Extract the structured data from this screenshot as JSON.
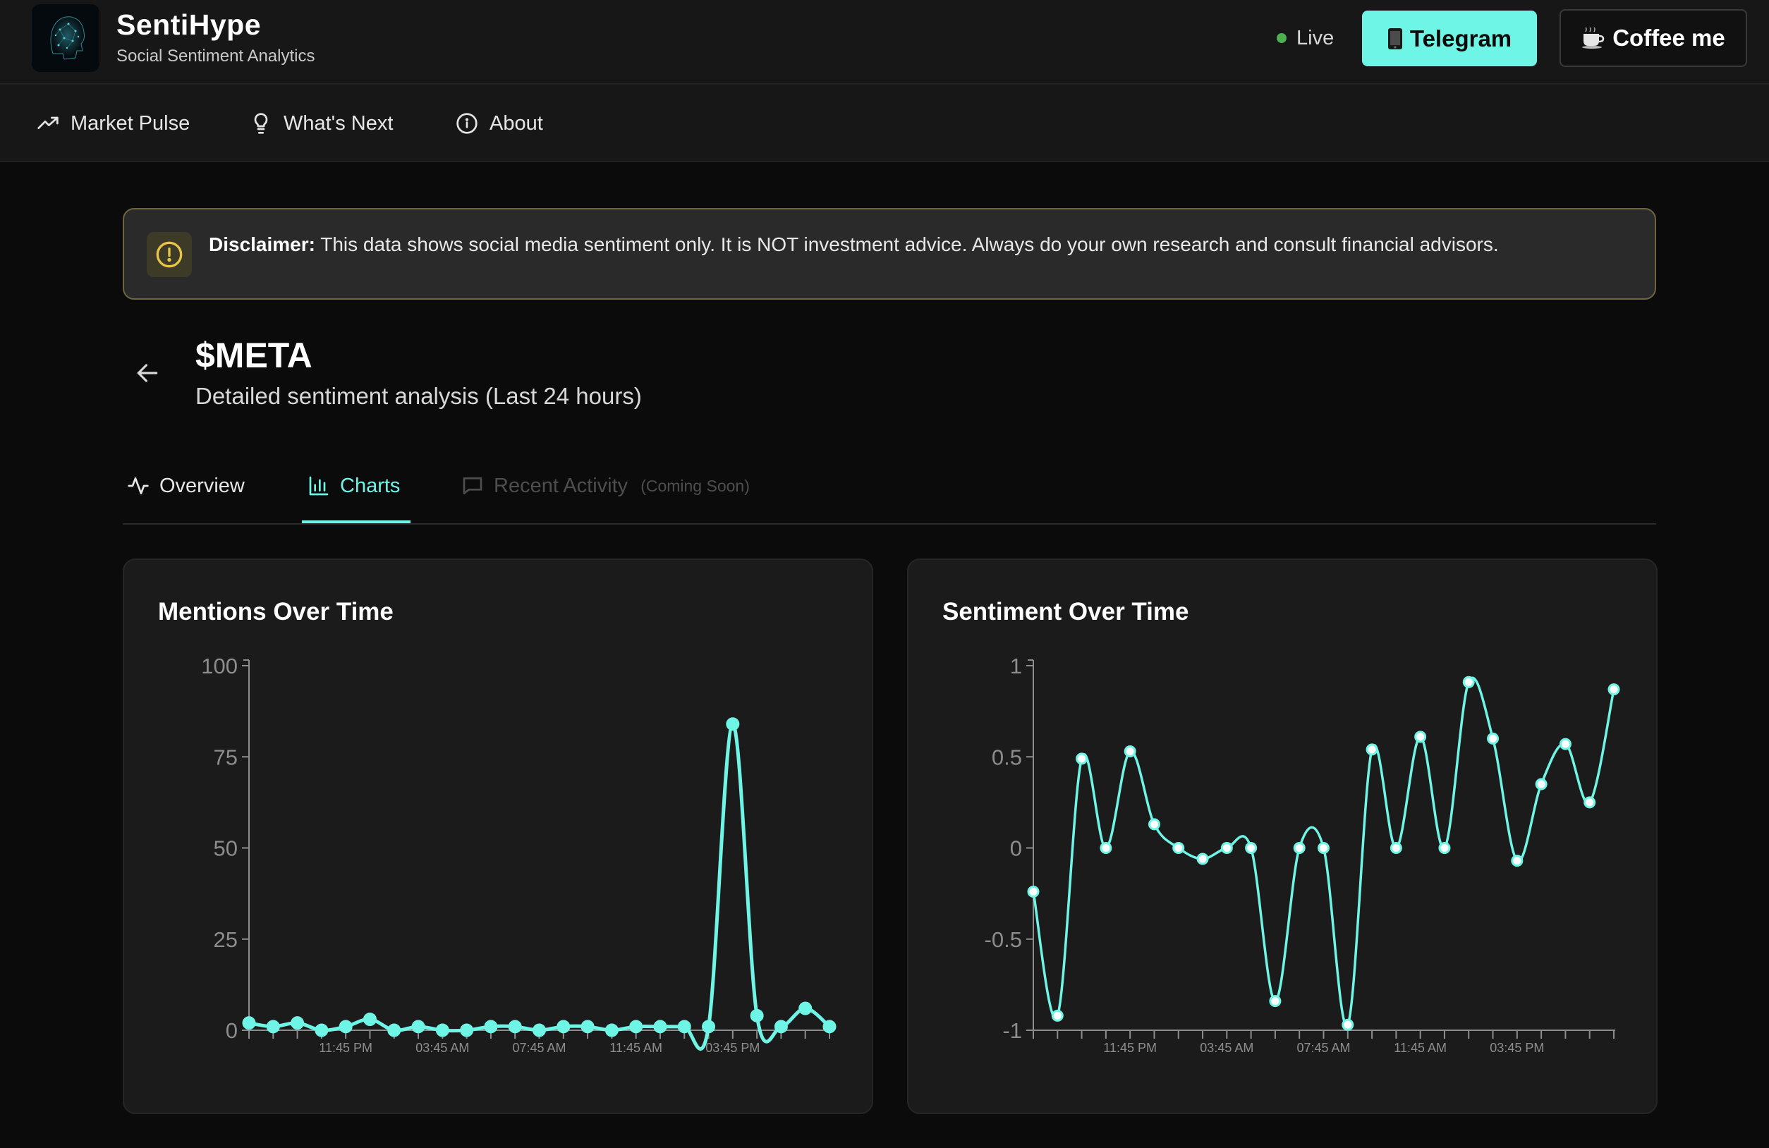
{
  "header": {
    "brand_title": "SentiHype",
    "brand_subtitle": "Social Sentiment Analytics",
    "live_label": "Live",
    "telegram_label": "Telegram",
    "telegram_icon": "phone-icon",
    "coffee_label": "Coffee me",
    "coffee_icon": "coffee-icon"
  },
  "nav": {
    "items": [
      {
        "label": "Market Pulse",
        "icon": "trending-up-icon"
      },
      {
        "label": "What's Next",
        "icon": "lightbulb-icon"
      },
      {
        "label": "About",
        "icon": "info-icon"
      }
    ]
  },
  "disclaimer": {
    "title": "Disclaimer:",
    "text": "This data shows social media sentiment only. It is NOT investment advice. Always do your own research and consult financial advisors."
  },
  "page": {
    "ticker": "$META",
    "subtitle": "Detailed sentiment analysis (Last 24 hours)"
  },
  "tabs": {
    "overview": "Overview",
    "charts": "Charts",
    "activity": "Recent Activity",
    "activity_note": "(Coming Soon)"
  },
  "colors": {
    "accent": "#6ff5e6",
    "live_dot": "#4caf50",
    "warning": "#e8c547",
    "background": "#0b0b0b",
    "card": "#1b1b1b"
  },
  "chart_data": [
    {
      "type": "line",
      "title": "Mentions Over Time",
      "ylim": [
        0,
        100
      ],
      "yticks": [
        0,
        25,
        50,
        75,
        100
      ],
      "x_tick_labels": [
        "11:45 PM",
        "03:45 AM",
        "07:45 AM",
        "11:45 AM",
        "03:45 PM"
      ],
      "x_tick_label_positions": [
        4,
        8,
        12,
        16,
        20
      ],
      "series": [
        {
          "values": [
            2,
            1,
            2,
            0,
            1,
            3,
            0,
            1,
            0,
            0,
            1,
            1,
            0,
            1,
            1,
            0,
            1,
            1,
            1,
            1,
            84,
            4,
            1,
            6,
            1
          ]
        }
      ]
    },
    {
      "type": "line",
      "title": "Sentiment Over Time",
      "ylim": [
        -1,
        1
      ],
      "yticks": [
        -1,
        -0.5,
        0,
        0.5,
        1
      ],
      "x_tick_labels": [
        "11:45 PM",
        "03:45 AM",
        "07:45 AM",
        "11:45 AM",
        "03:45 PM"
      ],
      "x_tick_label_positions": [
        4,
        8,
        12,
        16,
        20
      ],
      "series": [
        {
          "values": [
            -0.24,
            -0.92,
            0.49,
            0,
            0.53,
            0.13,
            0,
            -0.06,
            0,
            0,
            -0.84,
            0,
            0,
            -0.97,
            0.54,
            0,
            0.61,
            0,
            0.91,
            0.6,
            -0.07,
            0.35,
            0.57,
            0.25,
            0.87
          ]
        }
      ]
    }
  ]
}
